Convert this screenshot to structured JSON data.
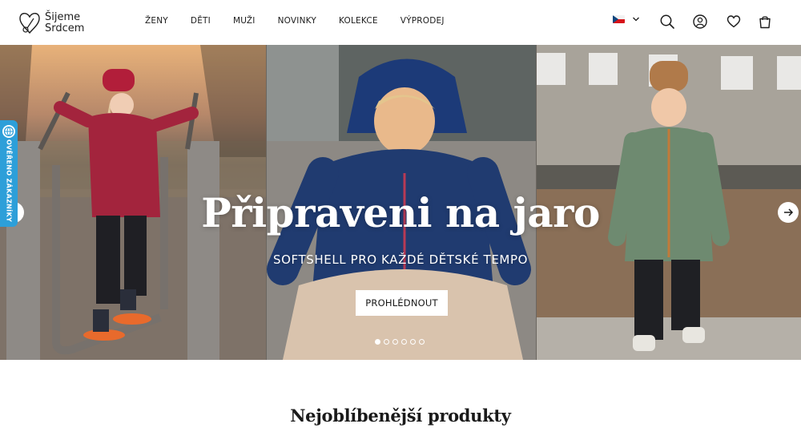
{
  "logo": {
    "line1": "Šijeme",
    "line2": "Srdcem"
  },
  "nav": [
    {
      "label": "ŽENY"
    },
    {
      "label": "DĚTI"
    },
    {
      "label": "MUŽI"
    },
    {
      "label": "NOVINKY"
    },
    {
      "label": "KOLEKCE"
    },
    {
      "label": "VÝPRODEJ"
    }
  ],
  "header_icons": [
    "czech-flag-icon",
    "chevron-down-icon",
    "search-icon",
    "account-icon",
    "heart-icon",
    "shopping-bag-icon"
  ],
  "hero": {
    "title": "Připraveni na jaro",
    "subtitle": "SOFTSHELL PRO KAŽDÉ DĚTSKÉ TEMPO",
    "button_label": "PROHLÉDNOUT",
    "slides_total": 6,
    "active_slide": 1
  },
  "badge": {
    "text": "OVĚŘENO ZÁKAZNÍKY"
  },
  "section": {
    "title": "Nejoblíbenější produkty"
  },
  "colors": {
    "badge": "#2d9fd9",
    "text": "#1a1a1a",
    "flag_red": "#d7141a",
    "flag_blue": "#11457e"
  }
}
